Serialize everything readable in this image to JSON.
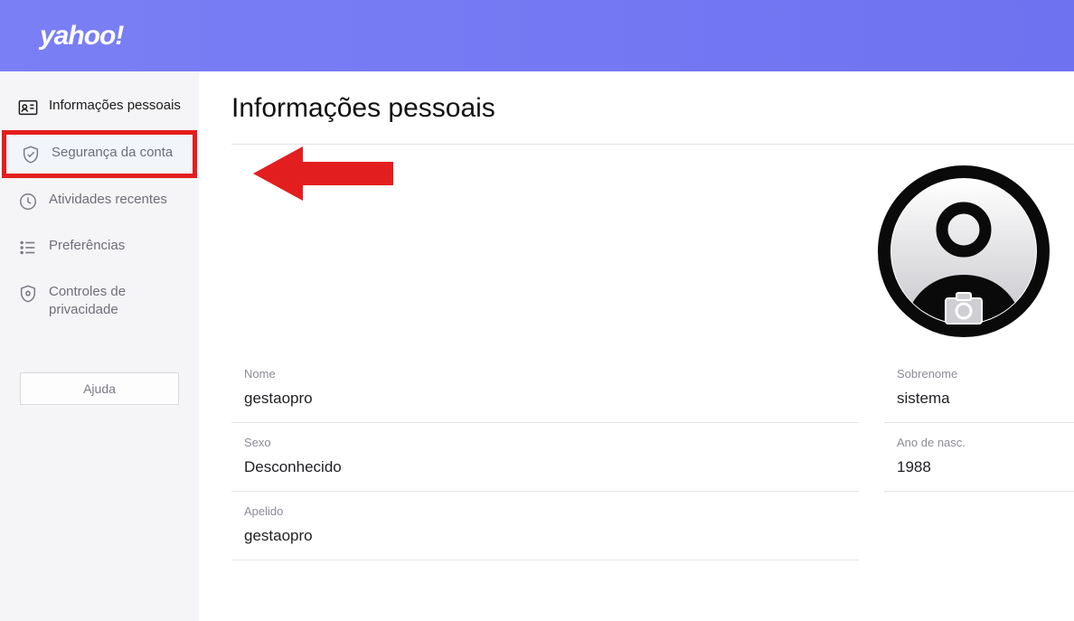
{
  "brand": "yahoo!",
  "sidebar": {
    "items": [
      {
        "label": "Informações pessoais"
      },
      {
        "label": "Segurança da conta"
      },
      {
        "label": "Atividades recentes"
      },
      {
        "label": "Preferências"
      },
      {
        "label": "Controles de privacidade"
      }
    ],
    "help": "Ajuda"
  },
  "main": {
    "title": "Informações pessoais",
    "fields": {
      "firstNameLabel": "Nome",
      "firstNameValue": "gestaopro",
      "lastNameLabel": "Sobrenome",
      "lastNameValue": "sistema",
      "genderLabel": "Sexo",
      "genderValue": "Desconhecido",
      "birthYearLabel": "Ano de nasc.",
      "birthYearValue": "1988",
      "nicknameLabel": "Apelido",
      "nicknameValue": "gestaopro"
    }
  }
}
